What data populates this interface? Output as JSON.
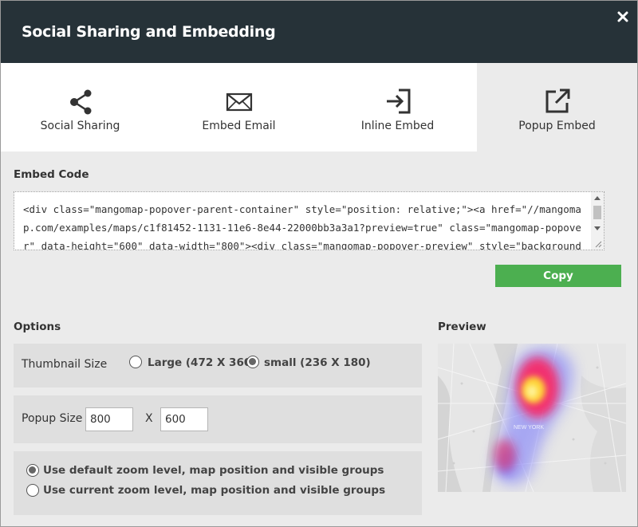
{
  "dialog": {
    "title": "Social Sharing and Embedding",
    "close_icon": "close-icon"
  },
  "tabs": [
    {
      "label": "Social Sharing",
      "icon": "share-icon",
      "active": false
    },
    {
      "label": "Embed Email",
      "icon": "envelope-icon",
      "active": false
    },
    {
      "label": "Inline Embed",
      "icon": "sign-in-icon",
      "active": false
    },
    {
      "label": "Popup Embed",
      "icon": "external-link-icon",
      "active": true
    }
  ],
  "embed": {
    "label": "Embed Code",
    "code": "<div class=\"mangomap-popover-parent-container\" style=\"position: relative;\"><a href=\"//mangomap.com/examples/maps/c1f81452-1131-11e6-8e44-22000bb3a3a1?preview=true\" class=\"mangomap-popover\" data-height=\"600\" data-width=\"800\"><div class=\"mangomap-popover-preview\" style=\"background-image: url(//mangomap.com/examples/maps/c1f81452-1131-11e6-8e44-22000bb3a3a1/thumbnail);\"></div></a></div>",
    "copy_label": "Copy"
  },
  "options": {
    "label": "Options",
    "thumbnail": {
      "label": "Thumbnail Size",
      "choices": [
        {
          "label": "Large (472 X 360)",
          "checked": false
        },
        {
          "label": "small (236 X 180)",
          "checked": true
        }
      ]
    },
    "popup": {
      "label": "Popup Size",
      "width": "800",
      "separator": "X",
      "height": "600"
    },
    "zoom": {
      "choices": [
        {
          "label": "Use default zoom level, map position and visible groups",
          "checked": true
        },
        {
          "label": "Use current zoom level, map position and visible groups",
          "checked": false
        }
      ]
    }
  },
  "preview": {
    "label": "Preview",
    "map_label": "NEW YORK"
  },
  "colors": {
    "header_bg": "#263238",
    "accent_green": "#4caf50",
    "panel_bg": "#ebebeb"
  }
}
